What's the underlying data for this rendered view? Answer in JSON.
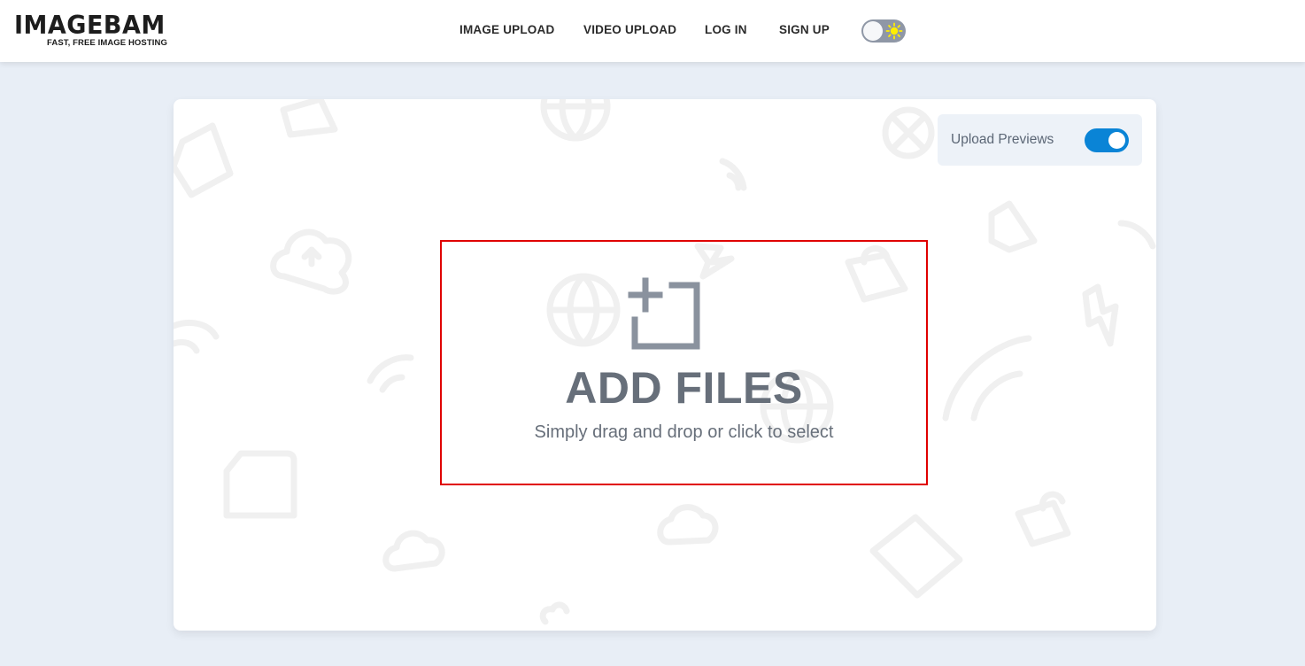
{
  "header": {
    "logo": {
      "main": "IMAGEBAM",
      "tagline": "FAST, FREE IMAGE HOSTING"
    },
    "nav": [
      {
        "label": "IMAGE UPLOAD"
      },
      {
        "label": "VIDEO UPLOAD"
      },
      {
        "label": "LOG IN"
      },
      {
        "label": "SIGN UP"
      }
    ],
    "theme_toggle": {
      "state": "light",
      "icon": "sun-icon"
    }
  },
  "upload": {
    "previews": {
      "label": "Upload Previews",
      "enabled": true
    },
    "dropzone": {
      "title": "ADD FILES",
      "subtitle": "Simply drag and drop or click to select",
      "icon": "add-file-icon"
    }
  },
  "colors": {
    "accent": "#0a84d6",
    "highlight_border": "#e00000",
    "text_muted": "#676f7a",
    "page_bg": "#e8eef6",
    "sun": "#ffee00"
  }
}
